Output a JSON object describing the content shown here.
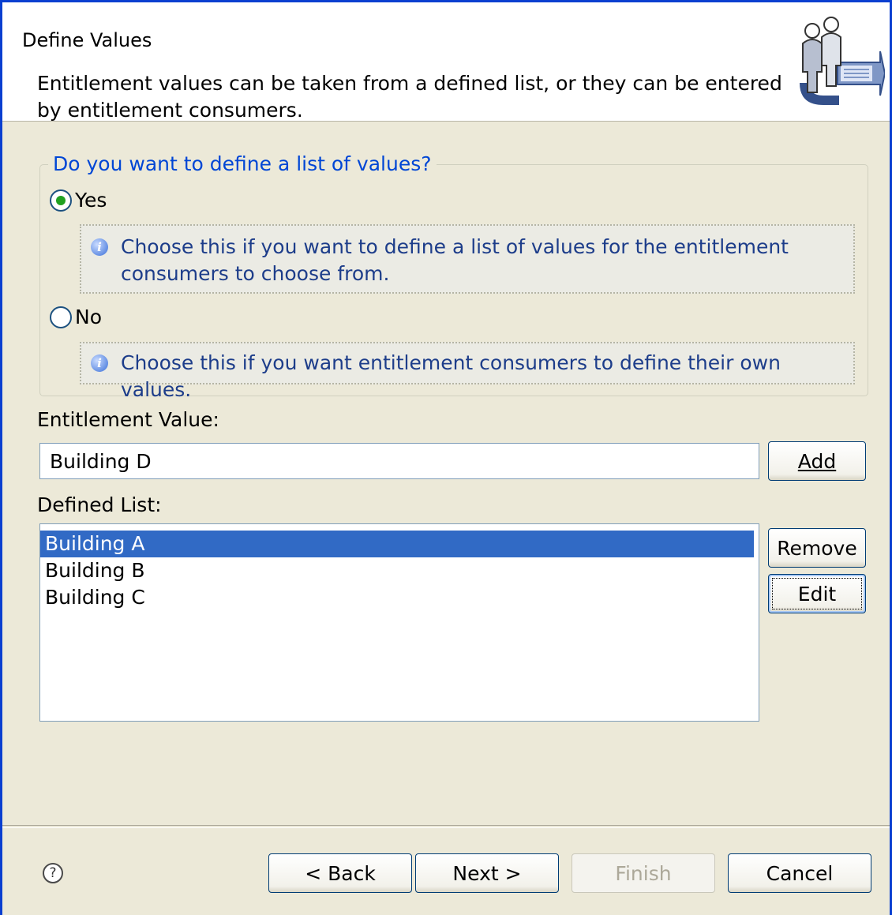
{
  "header": {
    "title": "Define Values",
    "description": "Entitlement values can be taken from a defined list, or they can be entered by entitlement consumers.",
    "icon": "people-transfer-icon"
  },
  "group": {
    "legend": "Do you want to define a list of values?",
    "options": [
      {
        "label": "Yes",
        "checked": true,
        "hint": "Choose this if you want to define a list of values for the entitlement consumers to choose from."
      },
      {
        "label": "No",
        "checked": false,
        "hint": "Choose this if you want entitlement consumers to define their own values."
      }
    ]
  },
  "entitlement": {
    "label": "Entitlement Value:",
    "value": "Building D",
    "add_label": "Add"
  },
  "defined_list": {
    "label": "Defined List:",
    "items": [
      "Building A",
      "Building B",
      "Building C"
    ],
    "selected": "Building A",
    "remove_label": "Remove",
    "edit_label": "Edit"
  },
  "footer": {
    "back_label": "< Back",
    "next_label": "Next >",
    "finish_label": "Finish",
    "cancel_label": "Cancel",
    "help_icon": "help-icon"
  },
  "colors": {
    "accent": "#0046d5",
    "selection": "#316ac5",
    "dialog_bg": "#ece9d8"
  }
}
